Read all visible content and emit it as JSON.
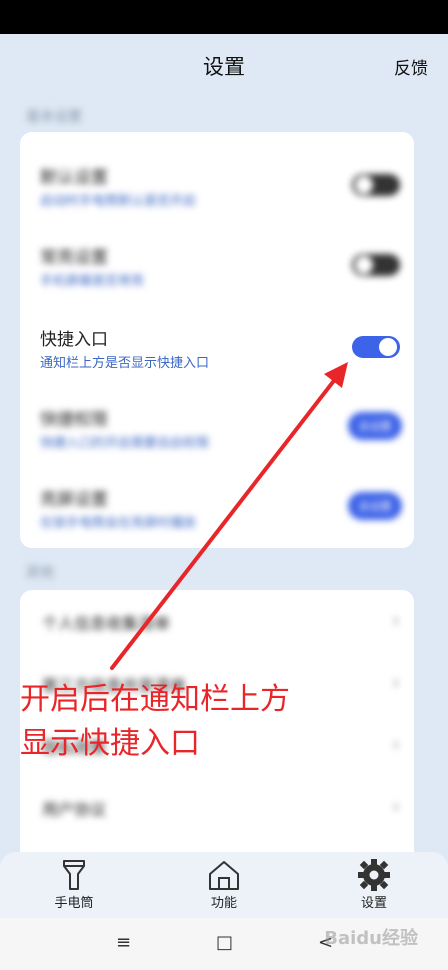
{
  "header": {
    "title": "设置",
    "feedback": "反馈"
  },
  "sections": {
    "basic": "基本设置",
    "other": "其他"
  },
  "settings": [
    {
      "title": "默认设置",
      "subtitle": "启动时手电筒默认是否开启",
      "control": "toggle",
      "state": "off"
    },
    {
      "title": "常亮设置",
      "subtitle": "手机屏幕是否常亮",
      "control": "toggle",
      "state": "off"
    },
    {
      "title": "快捷入口",
      "subtitle": "通知栏上方是否显示快捷入口",
      "control": "toggle",
      "state": "on"
    },
    {
      "title": "快捷权限",
      "subtitle": "快捷入口的开启需要自启权限",
      "control": "button",
      "button_label": "去设置"
    },
    {
      "title": "亮屏设置",
      "subtitle": "在锁手电筒会在亮屏时播放",
      "control": "button",
      "button_label": "去设置"
    }
  ],
  "other_items": [
    {
      "title": "个人信息收集清单"
    },
    {
      "title": "第三方信息共享清单"
    },
    {
      "title": "隐私政策"
    },
    {
      "title": "用户协议"
    }
  ],
  "tabs": [
    {
      "label": "手电筒",
      "icon": "flashlight-icon"
    },
    {
      "label": "功能",
      "icon": "home-icon"
    },
    {
      "label": "设置",
      "icon": "gear-icon"
    }
  ],
  "navbar": {
    "menu": "≡",
    "home": "□",
    "back": "<"
  },
  "annotation": {
    "line1": "开启后在通知栏上方",
    "line2": "显示快捷入口"
  },
  "watermark": "Baidu经验",
  "colors": {
    "accent": "#3d63e8",
    "annotation": "#e8262a",
    "background": "#dfe9f5"
  }
}
